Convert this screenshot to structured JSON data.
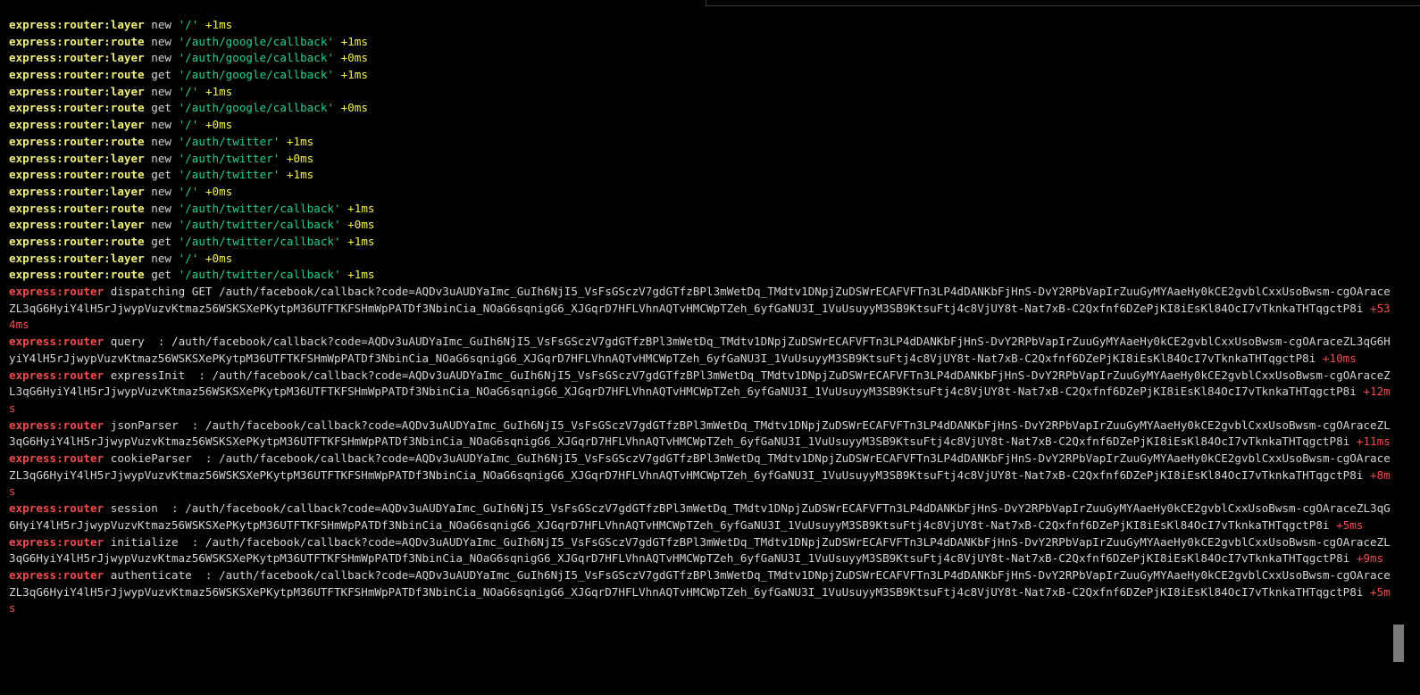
{
  "simple_lines": [
    {
      "ns": "express:router:layer",
      "method": "new",
      "path": "'/'",
      "diff": "+1ms"
    },
    {
      "ns": "express:router:route",
      "method": "new",
      "path": "'/auth/google/callback'",
      "diff": "+1ms"
    },
    {
      "ns": "express:router:layer",
      "method": "new",
      "path": "'/auth/google/callback'",
      "diff": "+0ms"
    },
    {
      "ns": "express:router:route",
      "method": "get",
      "path": "'/auth/google/callback'",
      "diff": "+1ms"
    },
    {
      "ns": "express:router:layer",
      "method": "new",
      "path": "'/'",
      "diff": "+1ms"
    },
    {
      "ns": "express:router:route",
      "method": "get",
      "path": "'/auth/google/callback'",
      "diff": "+0ms"
    },
    {
      "ns": "express:router:layer",
      "method": "new",
      "path": "'/'",
      "diff": "+0ms"
    },
    {
      "ns": "express:router:route",
      "method": "new",
      "path": "'/auth/twitter'",
      "diff": "+1ms"
    },
    {
      "ns": "express:router:layer",
      "method": "new",
      "path": "'/auth/twitter'",
      "diff": "+0ms"
    },
    {
      "ns": "express:router:route",
      "method": "get",
      "path": "'/auth/twitter'",
      "diff": "+1ms"
    },
    {
      "ns": "express:router:layer",
      "method": "new",
      "path": "'/'",
      "diff": "+0ms"
    },
    {
      "ns": "express:router:route",
      "method": "new",
      "path": "'/auth/twitter/callback'",
      "diff": "+1ms"
    },
    {
      "ns": "express:router:layer",
      "method": "new",
      "path": "'/auth/twitter/callback'",
      "diff": "+0ms"
    },
    {
      "ns": "express:router:route",
      "method": "get",
      "path": "'/auth/twitter/callback'",
      "diff": "+1ms"
    },
    {
      "ns": "express:router:layer",
      "method": "new",
      "path": "'/'",
      "diff": "+0ms"
    },
    {
      "ns": "express:router:route",
      "method": "get",
      "path": "'/auth/twitter/callback'",
      "diff": "+1ms"
    }
  ],
  "callback_url": "/auth/facebook/callback?code=AQDv3uAUDYaImc_GuIh6NjI5_VsFsGSczV7gdGTfzBPl3mWetDq_TMdtv1DNpjZuDSWrECAFVFTn3LP4dDANKbFjHnS-DvY2RPbVapIrZuuGyMYAaeHy0kCE2gvblCxxUsoBwsm-cgOAraceZL3qG6HyiY4lH5rJjwypVuzvKtmaz56WSKSXePKytpM36UTFTKFSHmWpPATDf3NbinCia_NOaG6sqnigG6_XJGqrD7HFLVhnAQTvHMCWpTZeh_6yfGaNU3I_1VuUsuyyM3SB9KtsuFtj4c8VjUY8t-Nat7xB-C2Qxfnf6DZePjKI8iEsKl84OcI7vTknkaTHTqgctP8i",
  "router_lines": [
    {
      "ns": "express:router",
      "label": "dispatching GET ",
      "diff": "+534ms"
    },
    {
      "ns": "express:router",
      "label": "query  : ",
      "diff": "+10ms"
    },
    {
      "ns": "express:router",
      "label": "expressInit  : ",
      "diff": "+12ms"
    },
    {
      "ns": "express:router",
      "label": "jsonParser  : ",
      "diff": "+11ms"
    },
    {
      "ns": "express:router",
      "label": "cookieParser  : ",
      "diff": "+8ms"
    },
    {
      "ns": "express:router",
      "label": "session  : ",
      "diff": "+5ms"
    },
    {
      "ns": "express:router",
      "label": "initialize  : ",
      "diff": "+9ms"
    },
    {
      "ns": "express:router",
      "label": "authenticate  : ",
      "diff": "+5ms"
    }
  ],
  "colors": {
    "background": "#000000",
    "namespace_yellow": "#f1f17a",
    "namespace_red": "#f14c4c",
    "string_green": "#23d18b"
  }
}
